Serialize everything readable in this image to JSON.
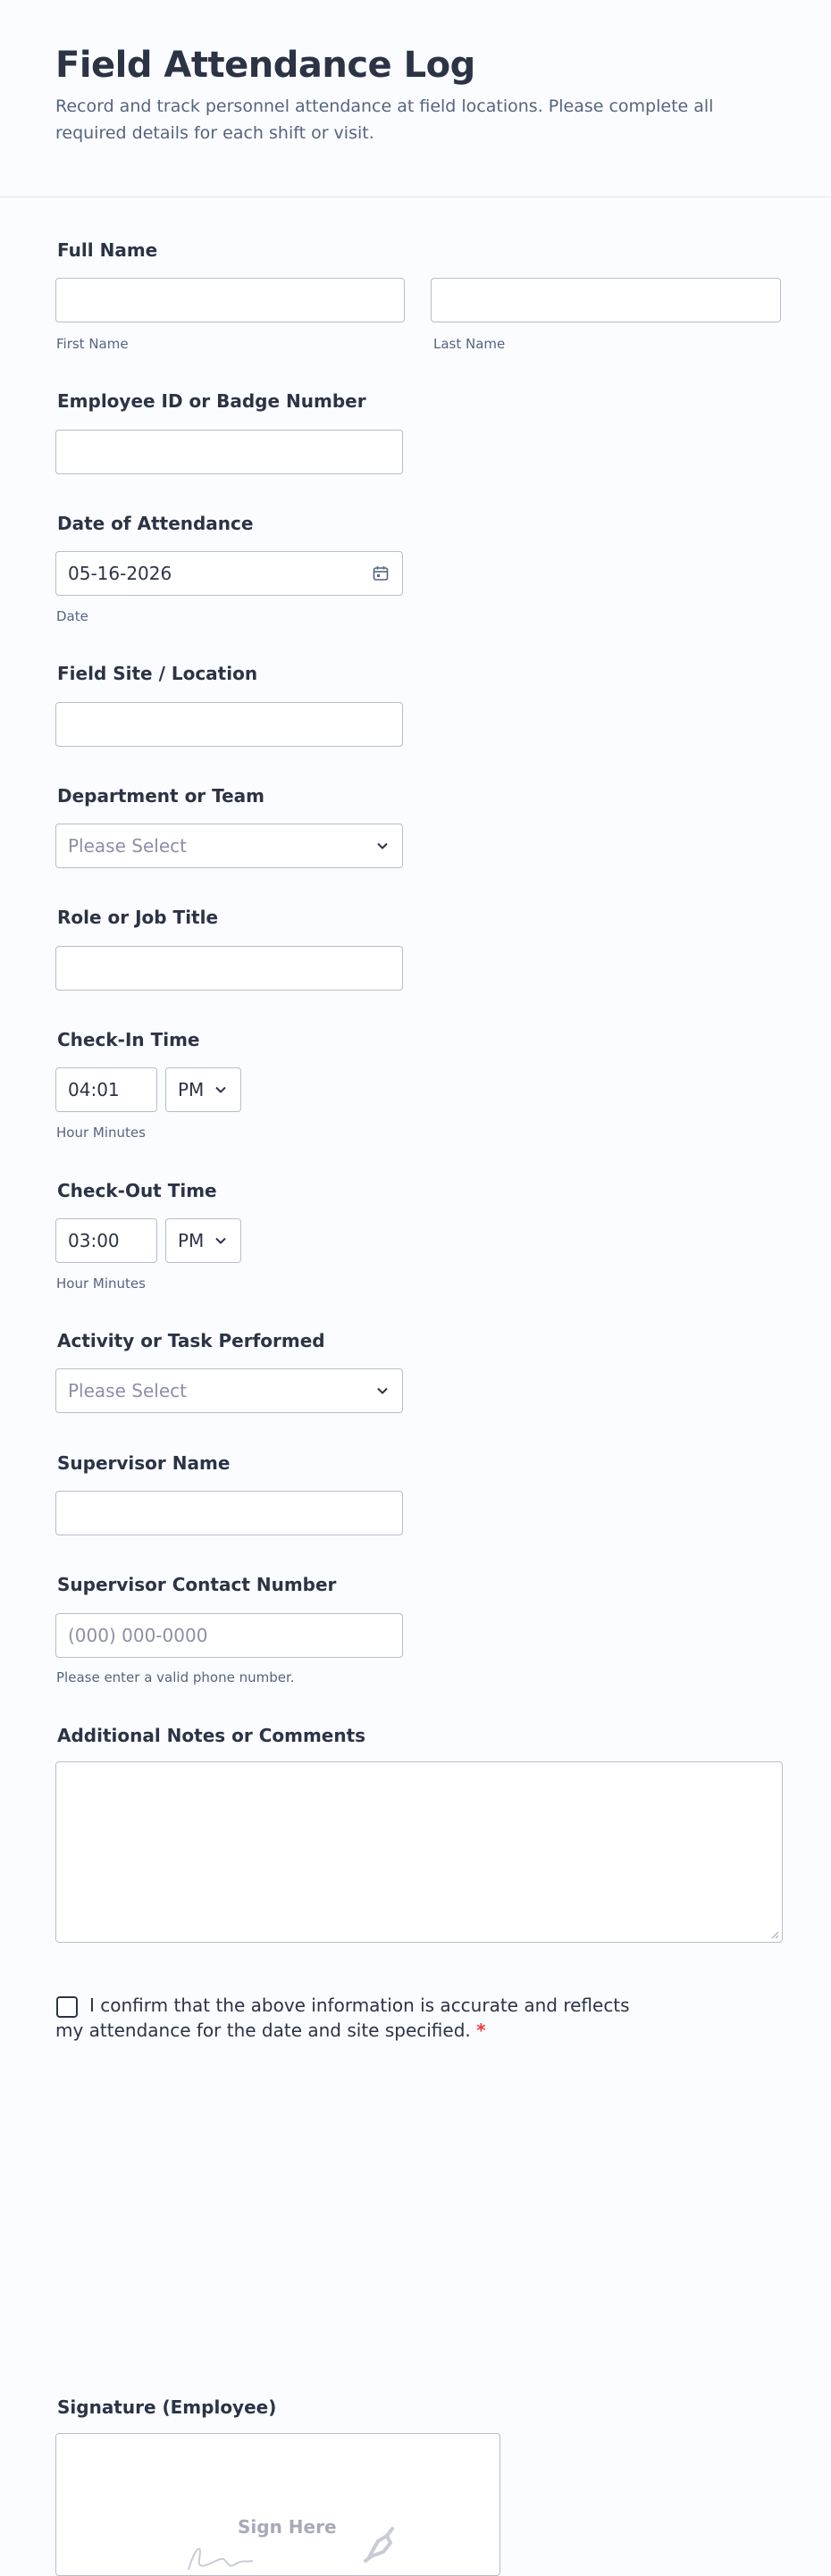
{
  "header": {
    "title": "Field Attendance Log",
    "subtitle": "Record and track personnel attendance at field locations. Please complete all required details for each shift or visit."
  },
  "fields": {
    "full_name": {
      "label": "Full Name",
      "first_sub": "First Name",
      "last_sub": "Last Name",
      "first_value": "",
      "last_value": ""
    },
    "employee_id": {
      "label": "Employee ID or Badge Number",
      "value": ""
    },
    "date": {
      "label": "Date of Attendance",
      "value": "05-16-2026",
      "sub": "Date"
    },
    "site": {
      "label": "Field Site / Location",
      "value": ""
    },
    "department": {
      "label": "Department or Team",
      "placeholder": "Please Select"
    },
    "role": {
      "label": "Role or Job Title",
      "value": ""
    },
    "check_in": {
      "label": "Check-In Time",
      "time": "04:01",
      "ampm": "PM",
      "sub": "Hour Minutes"
    },
    "check_out": {
      "label": "Check-Out Time",
      "time": "03:00",
      "ampm": "PM",
      "sub": "Hour Minutes"
    },
    "activity": {
      "label": "Activity or Task Performed",
      "placeholder": "Please Select"
    },
    "supervisor_name": {
      "label": "Supervisor Name",
      "value": ""
    },
    "supervisor_contact": {
      "label": "Supervisor Contact Number",
      "placeholder": "(000) 000-0000",
      "sub": "Please enter a valid phone number."
    },
    "notes": {
      "label": "Additional Notes or Comments",
      "value": ""
    },
    "confirm": {
      "text": "I confirm that the above information is accurate and reflects my attendance for the date and site specified.",
      "required_mark": "*"
    },
    "signature": {
      "label": "Signature (Employee)",
      "placeholder": "Sign Here"
    }
  },
  "icons": {
    "date": "calendar-icon",
    "select": "chevron-down-icon",
    "signature": "pen-icon"
  },
  "colors": {
    "text": "#2c3345",
    "muted": "#57647e",
    "border": "#b8bdc9",
    "required": "#f23a3c"
  }
}
